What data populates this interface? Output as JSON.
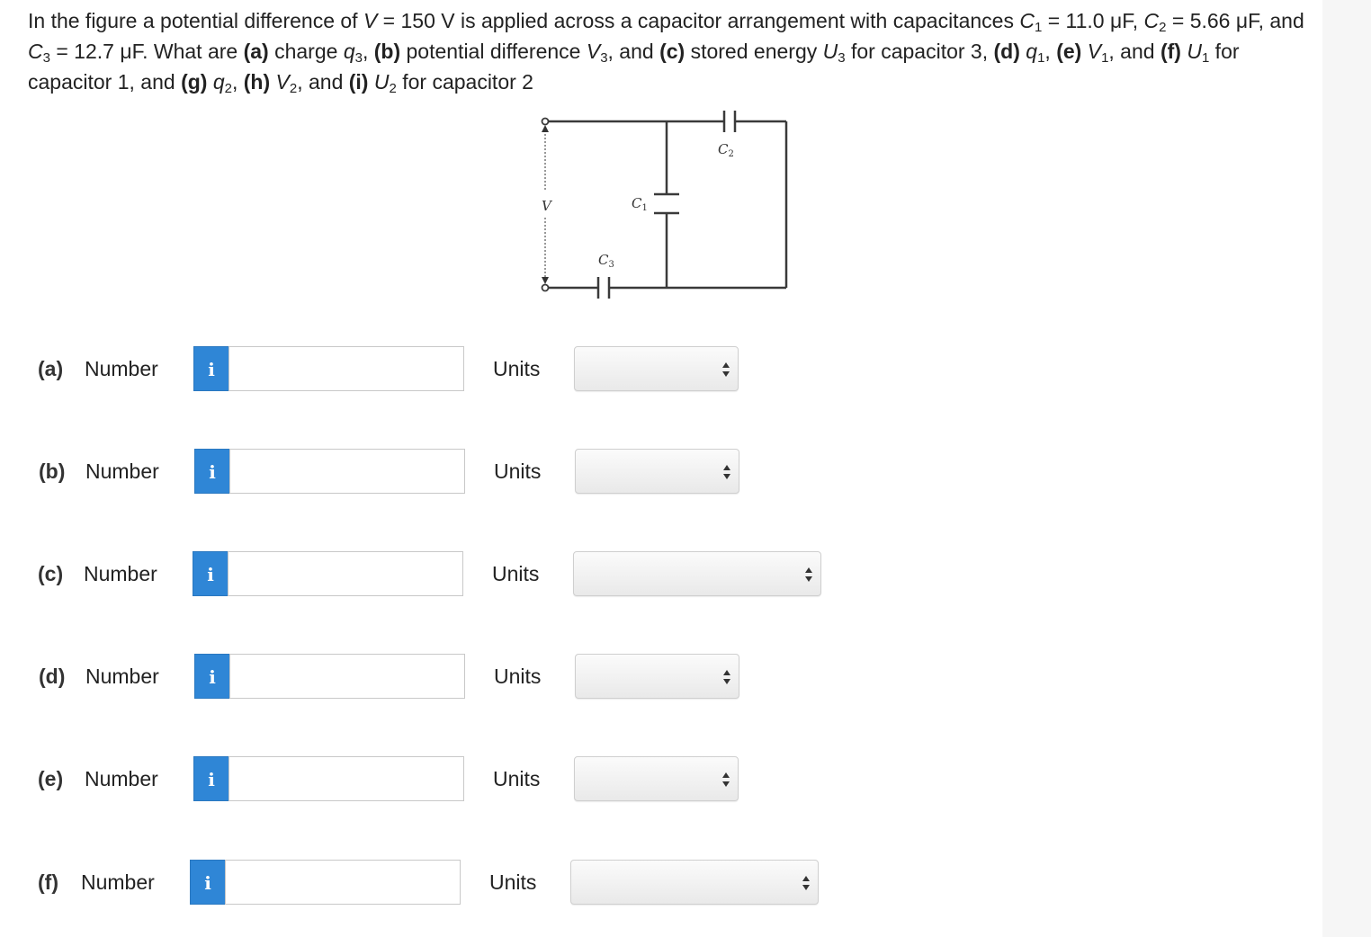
{
  "question": {
    "pre_v": "In the figure a potential difference of ",
    "var_V": "V",
    "v_value": " = 150 V is applied across a capacitor arrangement with capacitances ",
    "c1": "C",
    "c1_sub": "1",
    "c1_val": " = 11.0 μF, ",
    "c2": "C",
    "c2_sub": "2",
    "c2_val": " = 5.66 μF, and ",
    "c3": "C",
    "c3_sub": "3",
    "c3_val": " = 12.7 μF. What are ",
    "a_mark": "(a)",
    "a_text": " charge ",
    "q3": "q",
    "q3_sub": "3",
    "sep1": ", ",
    "b_mark": "(b)",
    "b_text": " potential difference ",
    "v3": "V",
    "v3_sub": "3",
    "and1": ", and ",
    "c_mark": "(c)",
    "c_text": " stored energy ",
    "u3": "U",
    "u3_sub": "3",
    "cap3_text": " for capacitor 3, ",
    "d_mark": "(d)",
    "q1": "q",
    "q1_sub": "1",
    "sep2": ", ",
    "e_mark": "(e)",
    "v1": "V",
    "v1_sub": "1",
    "and2": ", and ",
    "f_mark": "(f)",
    "u1": "U",
    "u1_sub": "1",
    "cap1_text": " for capacitor 1, and ",
    "g_mark": "(g)",
    "q2": "q",
    "q2_sub": "2",
    "sep3": ", ",
    "h_mark": "(h)",
    "v2": "V",
    "v2_sub": "2",
    "and3": ", and ",
    "i_mark": "(i)",
    "u2": "U",
    "u2_sub": "2",
    "cap2_text": " for capacitor 2"
  },
  "figure": {
    "label_v": "V",
    "label_c1": "C",
    "label_c1_sub": "1",
    "label_c2": "C",
    "label_c2_sub": "2",
    "label_c3": "C",
    "label_c3_sub": "3"
  },
  "answers": [
    {
      "part": "(a)",
      "number_label": "Number",
      "info": "i",
      "value": "",
      "units_label": "Units",
      "units_selected": ""
    },
    {
      "part": "(b)",
      "number_label": "Number",
      "info": "i",
      "value": "",
      "units_label": "Units",
      "units_selected": ""
    },
    {
      "part": "(c)",
      "number_label": "Number",
      "info": "i",
      "value": "",
      "units_label": "Units",
      "units_selected": ""
    },
    {
      "part": "(d)",
      "number_label": "Number",
      "info": "i",
      "value": "",
      "units_label": "Units",
      "units_selected": ""
    },
    {
      "part": "(e)",
      "number_label": "Number",
      "info": "i",
      "value": "",
      "units_label": "Units",
      "units_selected": ""
    },
    {
      "part": "(f)",
      "number_label": "Number",
      "info": "i",
      "value": "",
      "units_label": "Units",
      "units_selected": ""
    }
  ],
  "colors": {
    "info_button": "#2f86d6",
    "page_background": "#ffffff",
    "outer_background": "#f6f6f6"
  }
}
